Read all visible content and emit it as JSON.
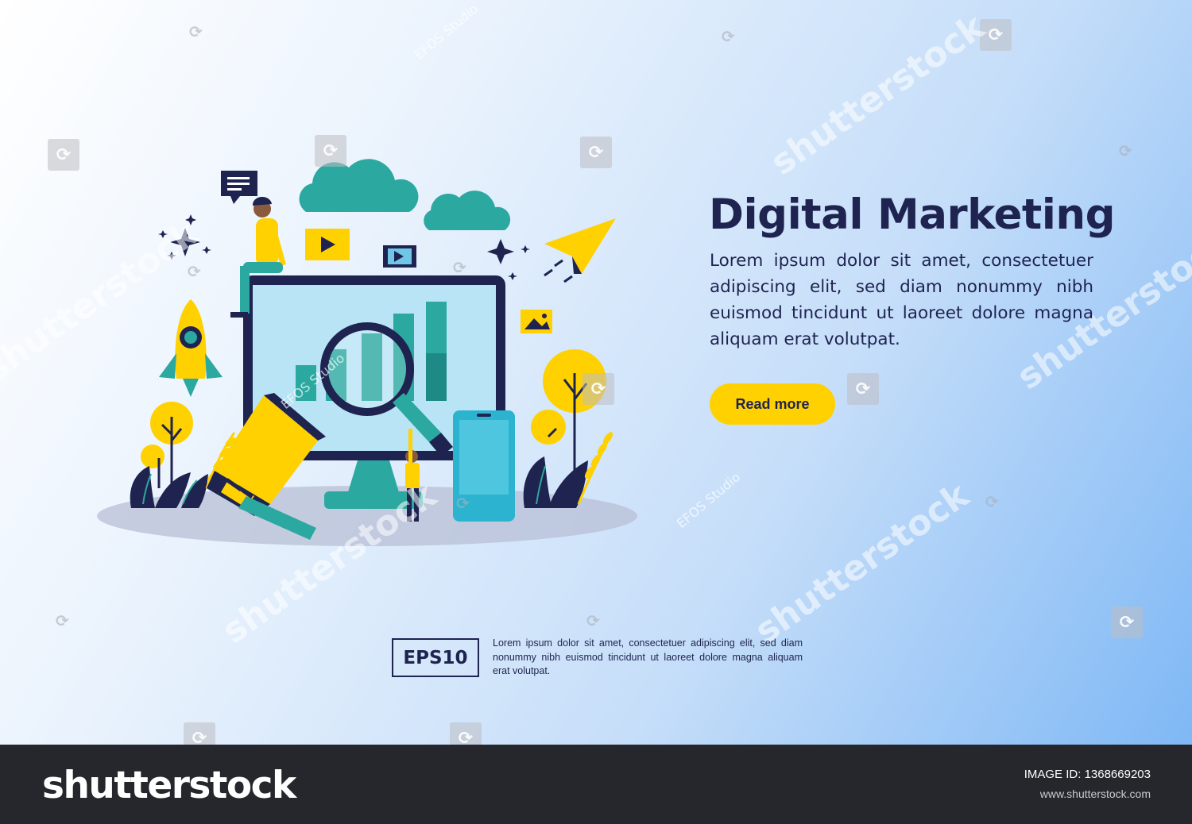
{
  "hero": {
    "title": "Digital Marketing",
    "body": "Lorem ipsum dolor sit amet, consectetuer adipiscing elit, sed diam nonummy nibh euismod tincidunt ut laoreet dolore magna aliquam  erat  volutpat.",
    "cta_label": "Read more"
  },
  "footnote": {
    "badge": "EPS10",
    "text": "Lorem ipsum dolor sit amet, consectetuer adipiscing elit, sed diam nonummy nibh euismod tincidunt ut laoreet dolore magna aliquam erat volutpat."
  },
  "watermark": {
    "brand": "shutterstock",
    "studio": "EFOS Studio"
  },
  "footer": {
    "brand": "shutterstock",
    "image_id_label": "IMAGE ID:",
    "image_id": "1368669203",
    "url": "www.shutterstock.com"
  },
  "colors": {
    "navy": "#1e2350",
    "yellow": "#ffd100",
    "teal": "#26a69a",
    "light_blue": "#b8e4f5",
    "footer_bg": "#25272c"
  },
  "icons": [
    "chat-bubble-icon",
    "cloud-icon",
    "video-play-icon",
    "film-icon",
    "paper-plane-icon",
    "rocket-icon",
    "image-icon",
    "star-icon",
    "megaphone-icon",
    "magnifier-icon",
    "phone-icon",
    "monitor-icon"
  ]
}
